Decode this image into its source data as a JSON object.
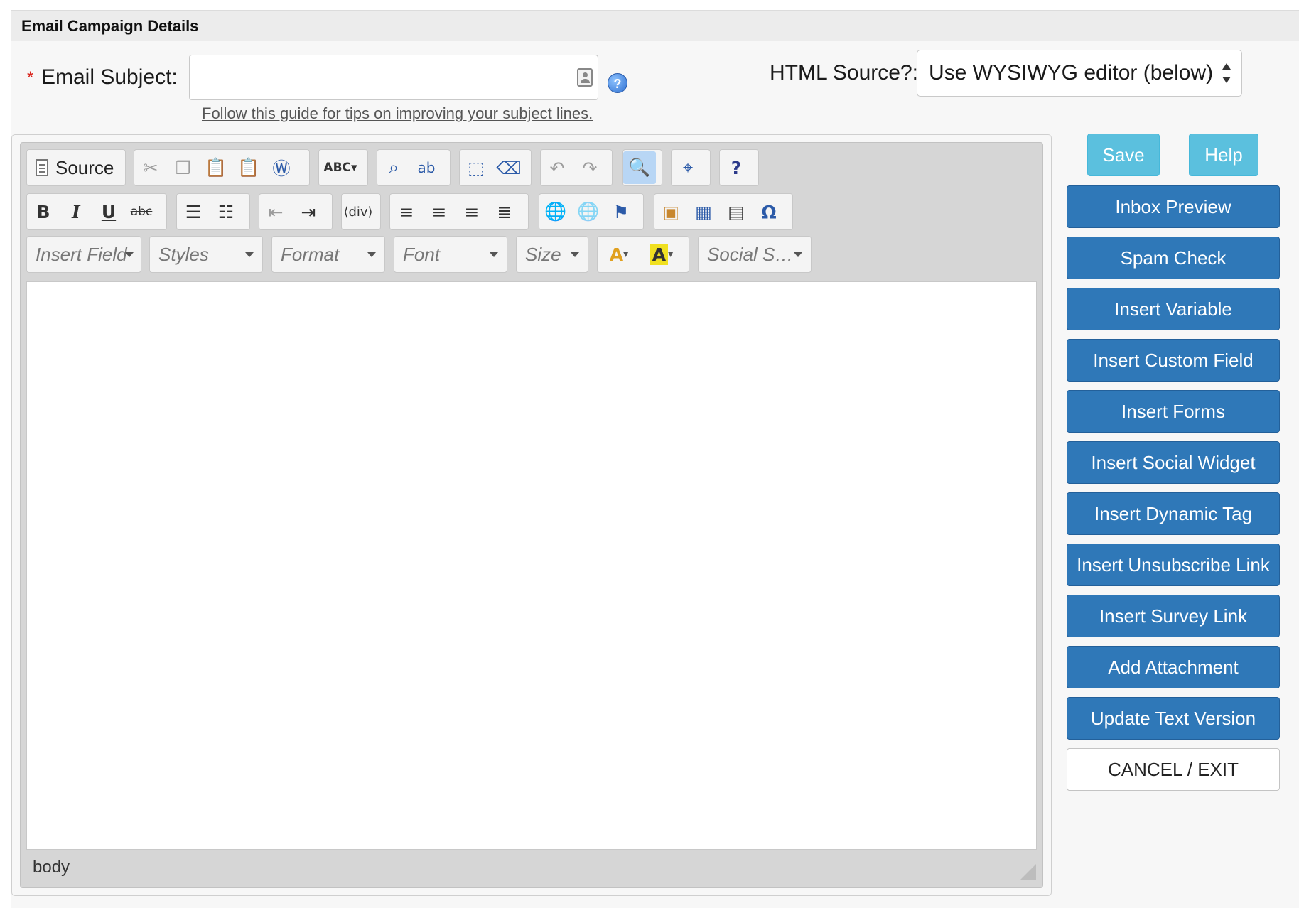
{
  "header": {
    "title": "Email Campaign Details"
  },
  "subject": {
    "required_mark": "*",
    "label": "Email Subject:",
    "value": "",
    "help_glyph": "?",
    "guide_link": "Follow this guide for tips on improving your subject lines."
  },
  "html_source": {
    "label": "HTML Source?:",
    "selected": "Use WYSIWYG editor (below)"
  },
  "editor": {
    "source_label": "Source",
    "combos": {
      "insert_field": "Insert Field",
      "styles": "Styles",
      "format": "Format",
      "font": "Font",
      "size": "Size",
      "social": "Social S…"
    },
    "glyphs": {
      "bold": "B",
      "italic": "I",
      "underline": "U",
      "strike": "abc",
      "omega": "Ω",
      "help": "?",
      "spell": "ABC",
      "replace": "ab",
      "font_color": "A",
      "bg_color": "A"
    },
    "status_path": "body"
  },
  "sidebar": {
    "save": "Save",
    "help": "Help",
    "buttons": [
      "Inbox Preview",
      "Spam Check",
      "Insert Variable",
      "Insert Custom Field",
      "Insert Forms",
      "Insert Social Widget",
      "Insert Dynamic Tag",
      "Insert Unsubscribe Link",
      "Insert Survey Link",
      "Add Attachment",
      "Update Text Version"
    ],
    "cancel": "CANCEL / EXIT"
  },
  "colors": {
    "primary_button": "#2f78b8",
    "info_button": "#5bc0de",
    "required": "#d9241c"
  }
}
